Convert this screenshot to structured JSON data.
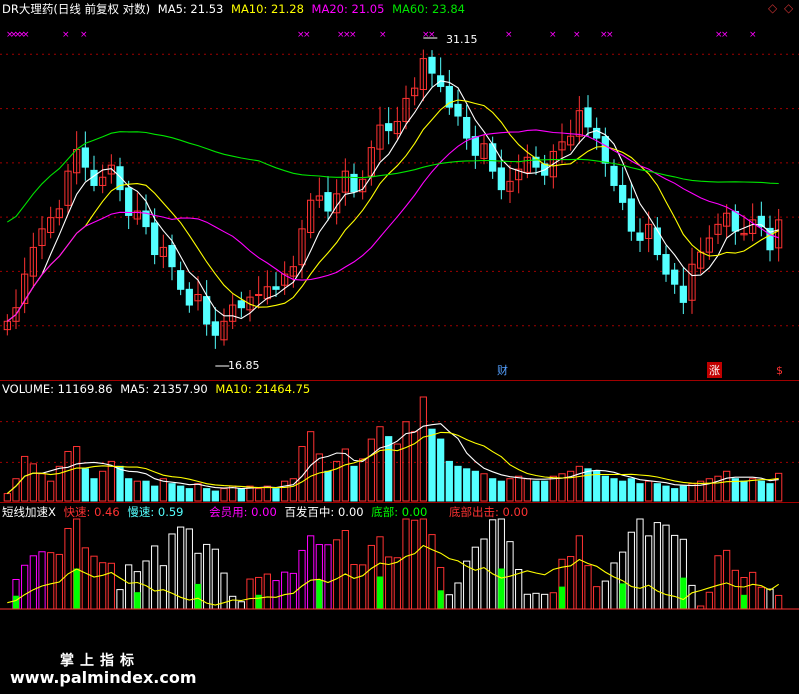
{
  "price_header": {
    "title": "DR大理药(日线 前复权 对数)",
    "ma5": "MA5: 21.53",
    "ma10": "MA10: 21.28",
    "ma20": "MA20: 21.05",
    "ma60": "MA60: 23.84"
  },
  "price_annotations": {
    "high": "31.15",
    "low": "16.85",
    "cai": "财",
    "zhang": "涨",
    "s": "$"
  },
  "volume_header": {
    "label": "VOLUME: 11169.86",
    "ma5": "MA5: 21357.90",
    "ma10": "MA10: 21464.75"
  },
  "indicator_header": {
    "name": "短线加速X",
    "fast": "快速: 0.46",
    "slow": "慢速: 0.59",
    "member": "会员用: 0.00",
    "baifa": "百发百中: 0.00",
    "bottom": "底部: 0.00",
    "exit": "底部出击: 0.00"
  },
  "watermark": {
    "line1": "掌上指标",
    "line2": "www.palmindex.com"
  },
  "colors": {
    "up": "#ff3232",
    "down": "#54ffff",
    "ma5": "#ffffff",
    "ma10": "#ffff00",
    "ma20": "#ff00ff",
    "ma60": "#00e600",
    "grid": "#a00000",
    "accent_green": "#00ff00"
  },
  "chart_data": {
    "type": "candlestick",
    "closes": [
      17.4,
      17.9,
      19.2,
      20.3,
      21.1,
      21.6,
      22.0,
      23.8,
      24.9,
      24.0,
      23.1,
      23.5,
      24.1,
      22.9,
      21.7,
      21.9,
      21.2,
      20.0,
      20.3,
      19.5,
      18.6,
      18.0,
      18.4,
      17.3,
      16.9,
      17.4,
      18.0,
      17.9,
      18.3,
      18.4,
      18.7,
      18.6,
      19.2,
      19.5,
      21.1,
      22.4,
      22.6,
      21.9,
      22.7,
      23.8,
      22.8,
      23.4,
      25.0,
      26.2,
      25.9,
      26.4,
      27.7,
      28.3,
      30.1,
      29.2,
      28.4,
      27.2,
      26.7,
      25.5,
      24.6,
      25.2,
      23.8,
      22.9,
      23.3,
      23.9,
      24.5,
      24.0,
      23.6,
      24.8,
      25.3,
      25.6,
      27.0,
      26.1,
      25.5,
      24.2,
      23.1,
      22.3,
      21.0,
      20.6,
      21.3,
      20.0,
      19.2,
      18.8,
      18.1,
      19.6,
      20.1,
      20.7,
      21.3,
      21.8,
      21.0,
      20.9,
      21.5,
      21.2,
      20.2,
      21.5
    ],
    "volume": [
      3000,
      9000,
      18000,
      15000,
      11000,
      8000,
      14000,
      20000,
      22000,
      13000,
      9000,
      12000,
      16000,
      14000,
      9000,
      8000,
      8000,
      6000,
      9000,
      7000,
      6000,
      5000,
      7000,
      5000,
      4000,
      5000,
      6000,
      5000,
      6000,
      5000,
      6000,
      5000,
      8000,
      9000,
      22000,
      28000,
      19000,
      12000,
      16000,
      21000,
      14000,
      17000,
      25000,
      30000,
      26000,
      23000,
      32000,
      28000,
      42000,
      29000,
      25000,
      16000,
      14000,
      13000,
      12000,
      11000,
      9000,
      8000,
      9000,
      10000,
      9000,
      8000,
      8000,
      10000,
      11000,
      12000,
      14000,
      13000,
      12000,
      10000,
      9000,
      8000,
      9000,
      7000,
      8000,
      7000,
      6000,
      5000,
      6000,
      7000,
      8000,
      9000,
      10000,
      12000,
      9000,
      8000,
      9000,
      8000,
      7000,
      11170
    ],
    "ylim": [
      16.85,
      31.15
    ]
  }
}
